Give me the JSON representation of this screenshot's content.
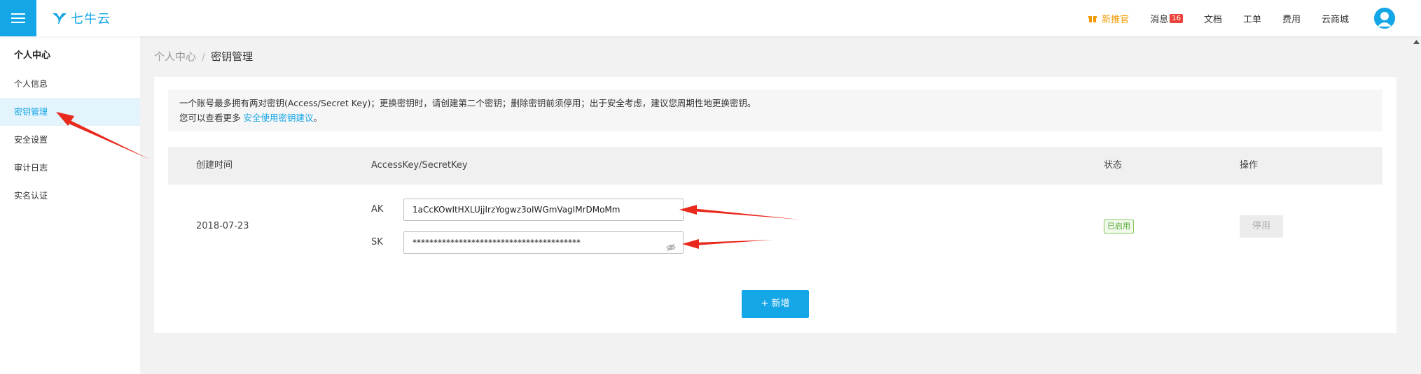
{
  "topbar": {
    "logo_text": "七牛云",
    "nav": {
      "new_promo": "新推官",
      "messages": "消息",
      "messages_count": "16",
      "docs": "文档",
      "ticket": "工单",
      "billing": "费用",
      "marketplace": "云商城"
    }
  },
  "sidebar": {
    "title": "个人中心",
    "items": [
      {
        "label": "个人信息"
      },
      {
        "label": "密钥管理"
      },
      {
        "label": "安全设置"
      },
      {
        "label": "审计日志"
      },
      {
        "label": "实名认证"
      }
    ]
  },
  "breadcrumb": {
    "parent": "个人中心",
    "separator": "/",
    "current": "密钥管理"
  },
  "notice": {
    "line1": "一个账号最多拥有两对密钥(Access/Secret Key)；更换密钥时，请创建第二个密钥；删除密钥前须停用；出于安全考虑，建议您周期性地更换密钥。",
    "line2_prefix": "您可以查看更多 ",
    "line2_link": "安全使用密钥建议",
    "line2_suffix": "。"
  },
  "table": {
    "headers": {
      "created": "创建时间",
      "key": "AccessKey/SecretKey",
      "status": "状态",
      "actions": "操作"
    },
    "rows": [
      {
        "created": "2018-07-23",
        "ak_label": "AK",
        "ak_value": "1aCcKOwItHXLUjjIrzYogwz3oIWGmVagIMrDMoMm",
        "sk_label": "SK",
        "sk_value": "****************************************",
        "status": "已启用",
        "action": "停用"
      }
    ]
  },
  "add_button": "+ 新增",
  "colors": {
    "accent": "#14a6e6",
    "annotation_red": "#e8291c",
    "status_green": "#52a832"
  }
}
